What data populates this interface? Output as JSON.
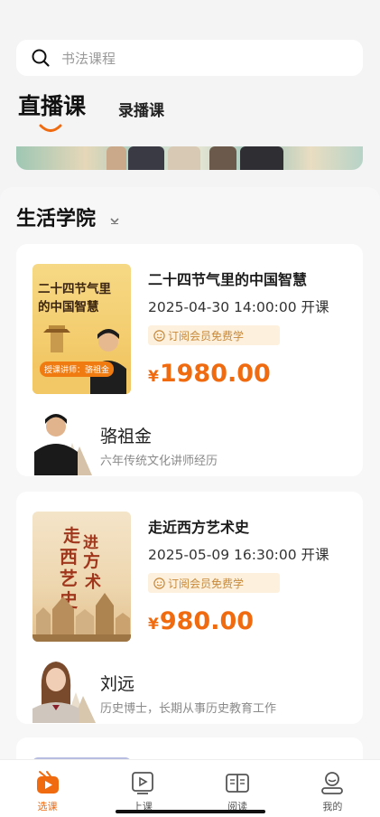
{
  "search": {
    "placeholder": "书法课程",
    "icon": "search-icon"
  },
  "tabs": [
    {
      "label": "直播课",
      "active": true
    },
    {
      "label": "录播课",
      "active": false
    }
  ],
  "section": {
    "title": "生活学院"
  },
  "courses": [
    {
      "title": "二十四节气里的中国智慧",
      "time": "2025-04-30 14:00:00 开课",
      "badge": "订阅会员免费学",
      "currency": "¥",
      "price": "1980.00",
      "cover_title_line1": "二十四节气里",
      "cover_title_line2": "的中国智慧",
      "cover_tag": "授课讲师：骆祖金",
      "teacher_name": "骆祖金",
      "teacher_desc": "六年传统文化讲师经历"
    },
    {
      "title": "走近西方艺术史",
      "time": "2025-05-09 16:30:00 开课",
      "badge": "订阅会员免费学",
      "currency": "¥",
      "price": "980.00",
      "cover_chars": [
        "走",
        "进",
        "西",
        "方",
        "艺",
        "术",
        "史"
      ],
      "teacher_name": "刘远",
      "teacher_desc": "历史博士，长期从事历史教育工作"
    }
  ],
  "tabbar": [
    {
      "label": "选课",
      "icon": "play-video-icon",
      "active": true
    },
    {
      "label": "上课",
      "icon": "video-frame-icon",
      "active": false
    },
    {
      "label": "阅读",
      "icon": "book-icon",
      "active": false
    },
    {
      "label": "我的",
      "icon": "user-icon",
      "active": false
    }
  ],
  "colors": {
    "accent": "#f06a0f",
    "badge_bg": "#fdf1de",
    "badge_text": "#c8893a"
  }
}
